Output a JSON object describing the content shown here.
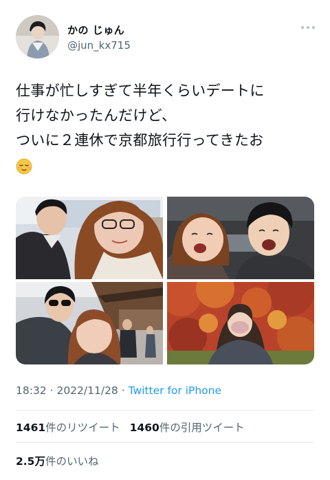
{
  "author": {
    "display_name": "かの じゅん",
    "handle": "@jun_kx715"
  },
  "tweet": {
    "lines": [
      "仕事が忙しすぎて半年くらいデートに",
      "行けなかったんだけど、",
      "ついに２連休で京都旅行行ってきたお"
    ],
    "emoji": "relieved-face"
  },
  "media": {
    "photos": [
      {
        "name": "couple-selfie-train"
      },
      {
        "name": "couple-selfie-car"
      },
      {
        "name": "couple-selfie-kyoto-street"
      },
      {
        "name": "woman-autumn-leaves"
      }
    ]
  },
  "meta": {
    "time": "18:32",
    "separator1": " · ",
    "date": "2022/11/28",
    "separator2": " · ",
    "source": "Twitter for iPhone"
  },
  "stats": {
    "retweets_count": "1461",
    "retweets_label": "件のリツイート",
    "quotes_count": "1460",
    "quotes_label": "件の引用ツイート",
    "likes_count": "2.5万",
    "likes_label": "件のいいね"
  },
  "colors": {
    "text": "#0f1419",
    "secondary": "#536471",
    "link": "#1d9bf0"
  }
}
